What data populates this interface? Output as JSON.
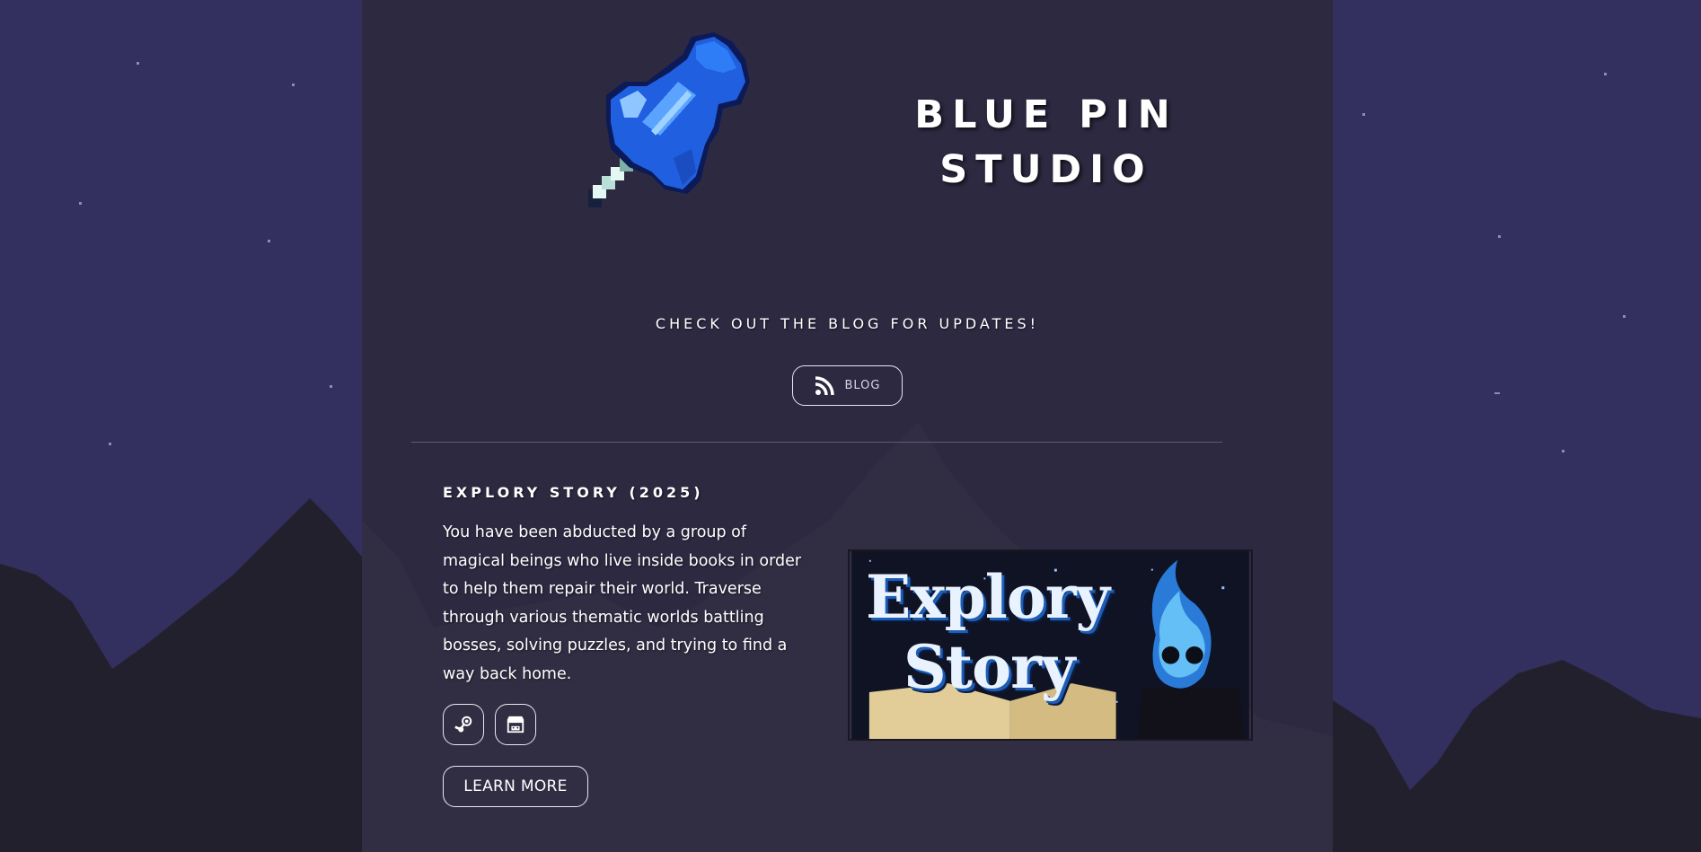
{
  "brand": {
    "name_line1": "BLUE PIN",
    "name_line2": "STUDIO"
  },
  "cta": {
    "text": "CHECK OUT THE BLOG FOR UPDATES!",
    "blog_button_label": "BLOG"
  },
  "game": {
    "title": "EXPLORY STORY (2025)",
    "description": "You have been abducted by a group of magical beings who live inside books in order to help them repair their world. Traverse through various thematic worlds battling bosses, solving puzzles, and trying to find a way back home.",
    "learn_more_label": "LEARN MORE",
    "banner_title_line1": "Explory",
    "banner_title_line2": "Story",
    "links": [
      {
        "icon": "steam-icon"
      },
      {
        "icon": "itch-io-icon"
      }
    ]
  },
  "colors": {
    "background": "#33305f",
    "panel": "#2c2940",
    "mountains_dark": "#24212f",
    "pin_blue": "#1f5fe0",
    "border": "#e9e7f2"
  }
}
